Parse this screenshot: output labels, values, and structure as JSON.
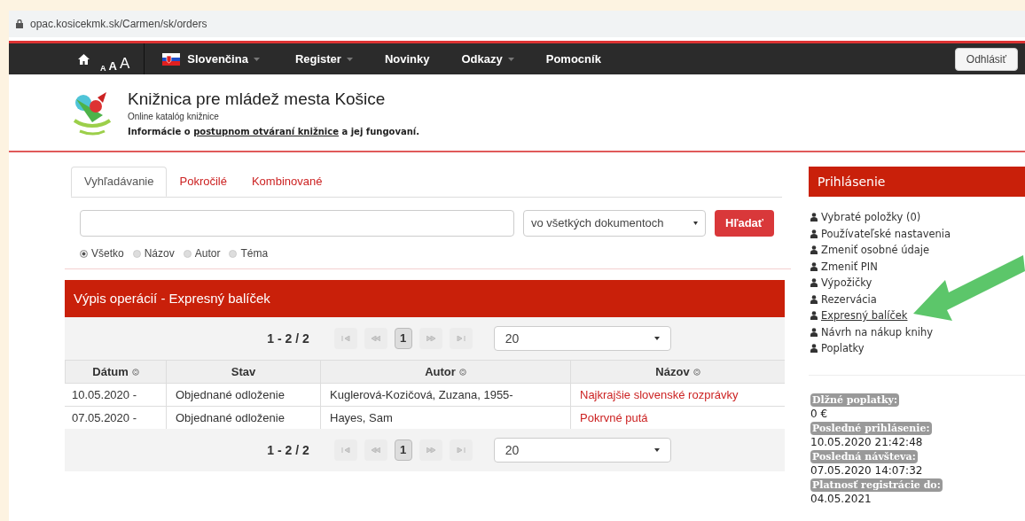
{
  "browser": {
    "url": "opac.kosicekmk.sk/Carmen/sk/orders"
  },
  "nav": {
    "font_sizes": [
      "A",
      "A",
      "A"
    ],
    "items": [
      {
        "label": "Slovenčina",
        "kind": "language",
        "dropdown": true
      },
      {
        "label": "Register",
        "kind": "menu",
        "dropdown": true
      },
      {
        "label": "Novinky",
        "kind": "menu",
        "dropdown": false
      },
      {
        "label": "Odkazy",
        "kind": "menu",
        "dropdown": true
      },
      {
        "label": "Pomocník",
        "kind": "menu",
        "dropdown": false
      }
    ],
    "logout": "Odhlásiť"
  },
  "header": {
    "title": "Knižnica pre mládež mesta Košice",
    "subtitle": "Online katalóg knižnice",
    "notice_before": "Informácie o",
    "notice_link": "postupnom otváraní knižnice",
    "notice_after": "a jej fungovaní."
  },
  "search": {
    "tabs": [
      {
        "label": "Vyhľadávanie",
        "selected": true
      },
      {
        "label": "Pokročilé",
        "selected": false
      },
      {
        "label": "Kombinované",
        "selected": false
      }
    ],
    "scope": "vo všetkých dokumentoch",
    "button": "Hľadať",
    "radios": [
      {
        "label": "Všetko",
        "selected": true
      },
      {
        "label": "Názov",
        "selected": false
      },
      {
        "label": "Autor",
        "selected": false
      },
      {
        "label": "Téma",
        "selected": false
      }
    ]
  },
  "panel": {
    "title": "Výpis operácií - Expresný balíček",
    "pager_top": {
      "range": "1 - 2 / 2",
      "pages": [
        {
          "label": "1",
          "selected": true
        }
      ],
      "page_size": "20"
    },
    "columns": [
      {
        "label": "Dátum",
        "sortable": true
      },
      {
        "label": "Stav",
        "sortable": false
      },
      {
        "label": "Autor",
        "sortable": true
      },
      {
        "label": "Názov",
        "sortable": true
      }
    ],
    "rows": [
      [
        "10.05.2020 -",
        "Objednané odloženie",
        "Kuglerová-Kozičová, Zuzana, 1955-",
        "Najkrajšie slovenské rozprávky"
      ],
      [
        "07.05.2020 -",
        "Objednané odloženie",
        "Hayes, Sam",
        "Pokrvné putá"
      ]
    ],
    "pager_bottom": {
      "range": "1 - 2 / 2",
      "pages": [
        {
          "label": "1",
          "selected": true
        }
      ],
      "page_size": "20"
    }
  },
  "sidebar": {
    "title": "Prihlásenie",
    "items": [
      {
        "label": "Vybraté položky (0)",
        "selected": false
      },
      {
        "label": "Používateľské nastavenia",
        "selected": false
      },
      {
        "label": "Zmeniť osobné údaje",
        "selected": false
      },
      {
        "label": "Zmeniť PIN",
        "selected": false
      },
      {
        "label": "Výpožičky",
        "selected": false
      },
      {
        "label": "Rezervácia",
        "selected": false
      },
      {
        "label": "Expresný balíček",
        "selected": true
      },
      {
        "label": "Návrh na nákup knihy",
        "selected": false
      },
      {
        "label": "Poplatky",
        "selected": false
      }
    ],
    "info": [
      {
        "label": "Dlžné poplatky:",
        "value": "0 €"
      },
      {
        "label": "Posledné prihlásenie:",
        "value": "10.05.2020 21:42:48"
      },
      {
        "label": "Posledná návšteva:",
        "value": "07.05.2020 14:07:32"
      },
      {
        "label": "Platnosť registrácie do:",
        "value": "04.05.2021"
      }
    ]
  }
}
